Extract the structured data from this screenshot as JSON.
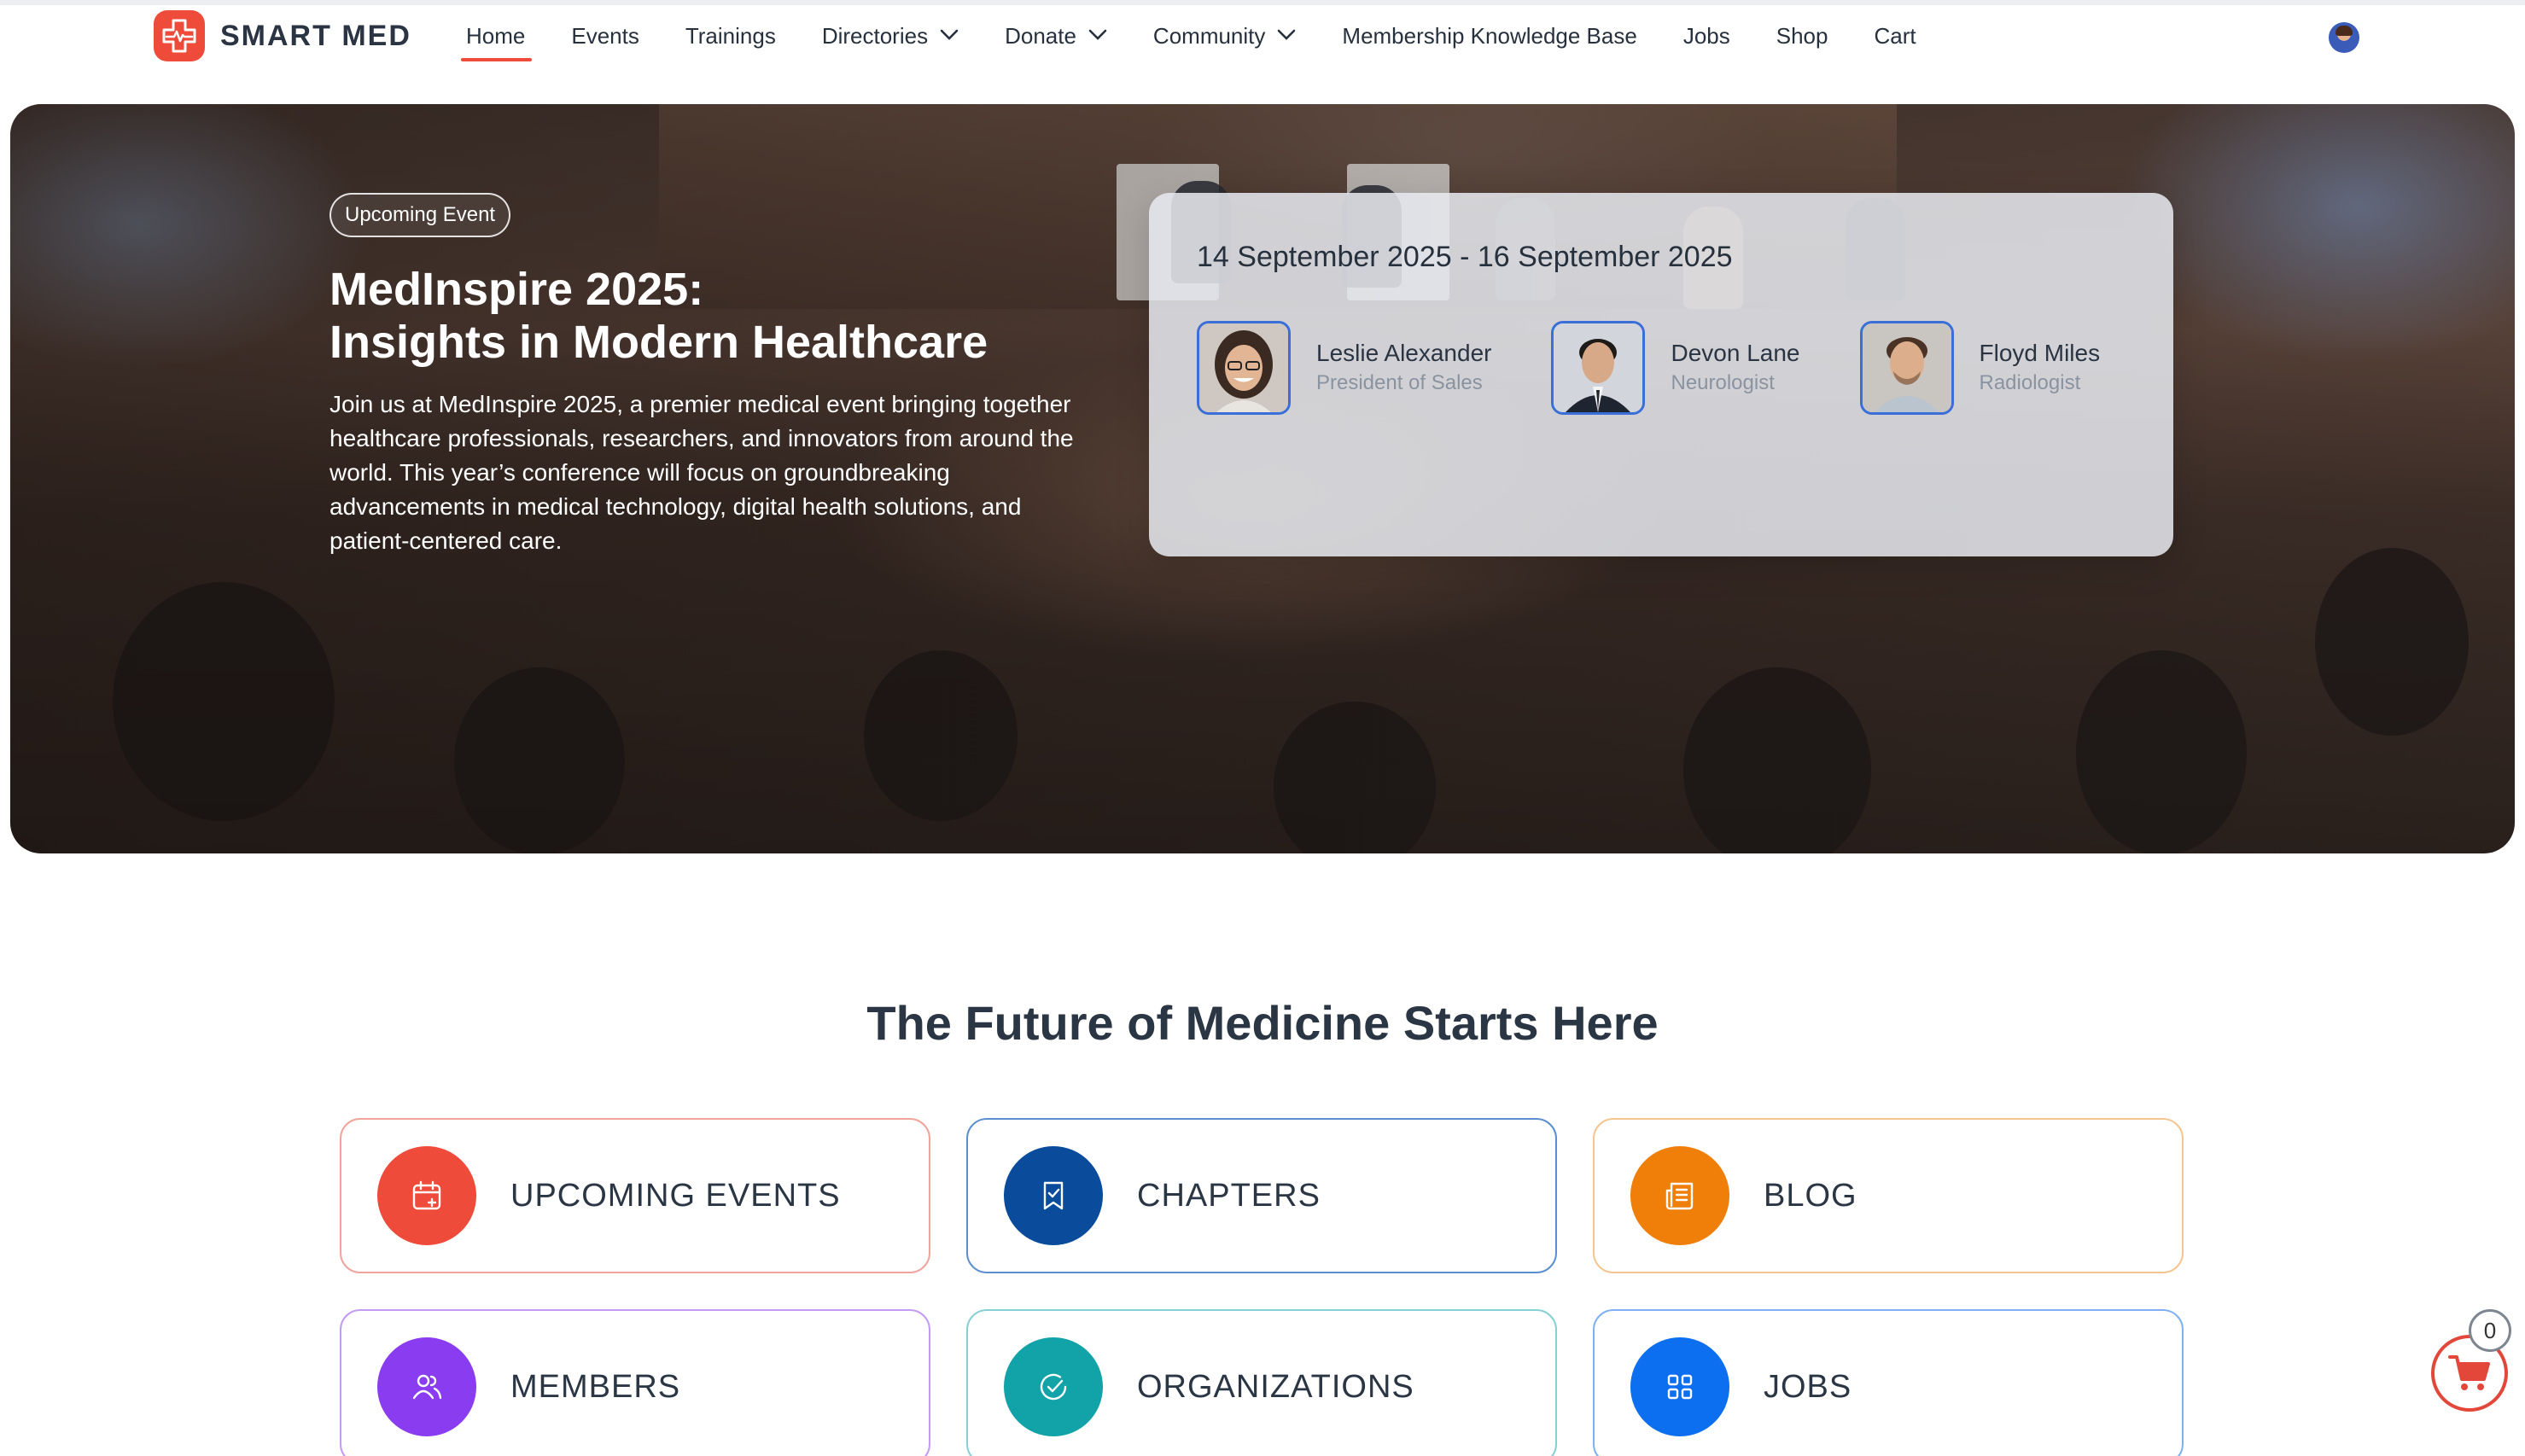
{
  "brand": {
    "name": "SMART MED",
    "accent": "#ee4b3a"
  },
  "nav": {
    "items": [
      {
        "label": "Home",
        "active": true,
        "dropdown": false
      },
      {
        "label": "Events",
        "dropdown": false
      },
      {
        "label": "Trainings",
        "dropdown": false
      },
      {
        "label": "Directories",
        "dropdown": true
      },
      {
        "label": "Donate",
        "dropdown": true
      },
      {
        "label": "Community",
        "dropdown": true
      },
      {
        "label": "Membership Knowledge Base",
        "dropdown": false
      },
      {
        "label": "Jobs",
        "dropdown": false
      },
      {
        "label": "Shop",
        "dropdown": false
      },
      {
        "label": "Cart",
        "dropdown": false
      }
    ]
  },
  "hero": {
    "badge": "Upcoming Event",
    "title_line1": "MedInspire 2025:",
    "title_line2": "Insights in Modern Healthcare",
    "description": "Join us at MedInspire 2025, a premier medical event bringing together healthcare professionals, researchers, and innovators from around the world. This year’s conference will focus on groundbreaking advancements in medical technology, digital health solutions, and patient-centered care.",
    "event_card": {
      "date_range": "14 September 2025 - 16 September 2025",
      "speakers": [
        {
          "name": "Leslie Alexander",
          "role": "President of Sales"
        },
        {
          "name": "Devon Lane",
          "role": "Neurologist"
        },
        {
          "name": "Floyd Miles",
          "role": "Radiologist"
        }
      ]
    }
  },
  "features": {
    "title": "The Future of Medicine Starts Here",
    "tiles": [
      {
        "label": "UPCOMING EVENTS",
        "icon": "calendar-plus-icon",
        "color": "#ee4b3a",
        "border": "#f2a39b"
      },
      {
        "label": "CHAPTERS",
        "icon": "bookmark-check-icon",
        "color": "#0a4c9b",
        "border": "#5c8fcf"
      },
      {
        "label": "BLOG",
        "icon": "newspaper-icon",
        "color": "#f07f0a",
        "border": "#f5c58f"
      },
      {
        "label": "MEMBERS",
        "icon": "users-icon",
        "color": "#8a3cf0",
        "border": "#c49bf4"
      },
      {
        "label": "ORGANIZATIONS",
        "icon": "badge-check-icon",
        "color": "#12a3a8",
        "border": "#86d0d4"
      },
      {
        "label": "JOBS",
        "icon": "grid-icon",
        "color": "#0b6ff0",
        "border": "#7fb0f3"
      }
    ]
  },
  "cart_fab": {
    "count": "0",
    "icon": "cart-icon",
    "color": "#e2473a"
  }
}
